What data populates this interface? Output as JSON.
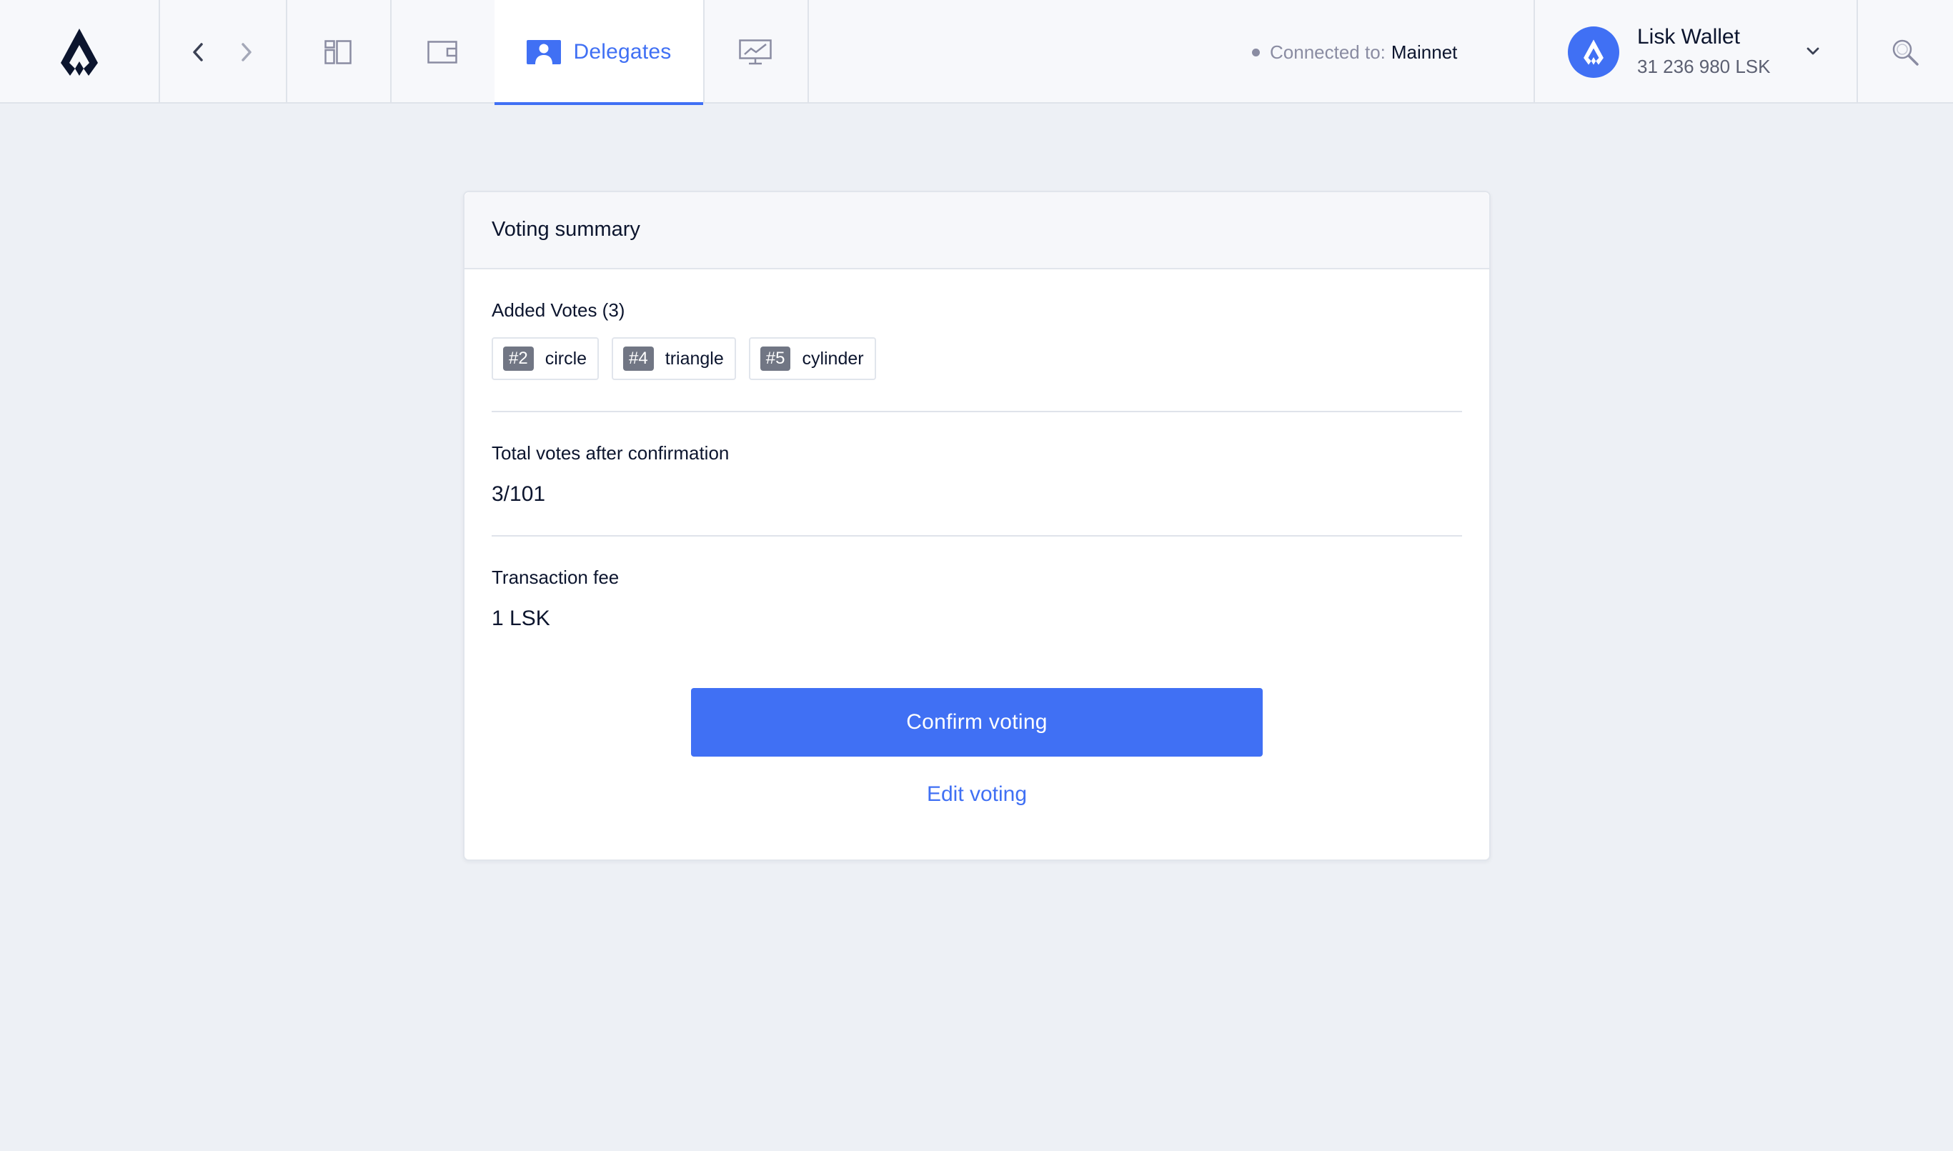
{
  "header": {
    "tabs": {
      "dashboard_icon": "dashboard-icon",
      "wallet_icon": "wallet-icon",
      "delegates_label": "Delegates",
      "delegates_icon": "delegates-icon",
      "monitor_icon": "monitor-icon"
    },
    "connection": {
      "label": "Connected to:",
      "network": "Mainnet"
    },
    "account": {
      "name": "Lisk Wallet",
      "balance": "31 236 980 LSK"
    }
  },
  "summary": {
    "title": "Voting summary",
    "added_votes_label": "Added Votes (3)",
    "added_votes": [
      {
        "rank": "#2",
        "name": "circle"
      },
      {
        "rank": "#4",
        "name": "triangle"
      },
      {
        "rank": "#5",
        "name": "cylinder"
      }
    ],
    "total_votes_label": "Total votes after confirmation",
    "total_votes_value": "3/101",
    "fee_label": "Transaction fee",
    "fee_value": "1 LSK",
    "confirm_label": "Confirm voting",
    "edit_label": "Edit voting"
  },
  "colors": {
    "accent": "#4070f4",
    "background": "#edf0f5",
    "text": "#0c152e",
    "muted": "#8a8ca2",
    "rank_badge": "#717684"
  }
}
